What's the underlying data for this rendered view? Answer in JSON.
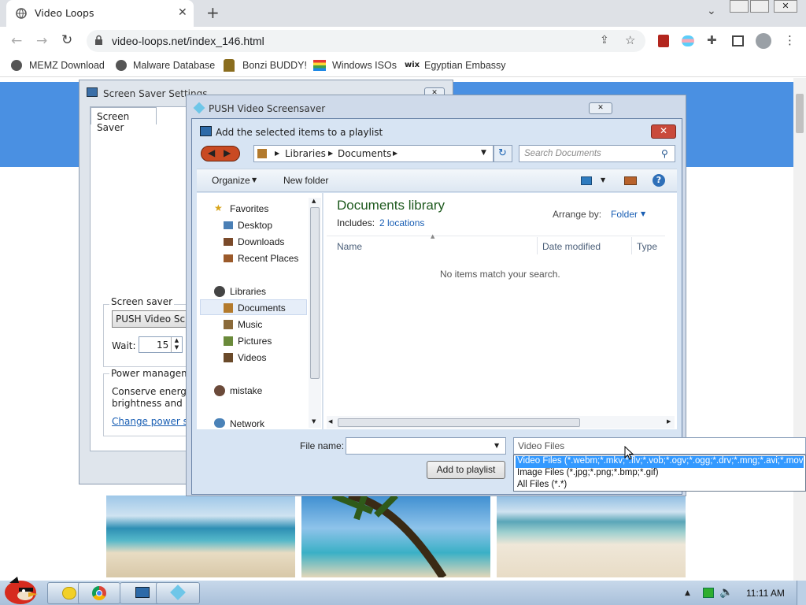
{
  "browser": {
    "tab_title": "Video Loops",
    "url": "video-loops.net/index_146.html",
    "bookmarks": [
      "MEMZ Download",
      "Malware Database",
      "Bonzi BUDDY!",
      "Windows ISOs",
      "Egyptian Embassy"
    ]
  },
  "screensaver_window": {
    "title": "Screen Saver Settings",
    "tab": "Screen Saver",
    "group_label": "Screen saver",
    "selected": "PUSH Video Scree",
    "wait_label": "Wait:",
    "wait_value": "15",
    "power_label": "Power manageme",
    "power_text1": "Conserve energy o",
    "power_text2": "brightness and oth",
    "power_link": "Change power set"
  },
  "push_window": {
    "title": "PUSH Video Screensaver"
  },
  "dialog": {
    "title": "Add the selected items to a playlist",
    "breadcrumb": [
      "Libraries",
      "Documents"
    ],
    "search_placeholder": "Search Documents",
    "organize": "Organize",
    "new_folder": "New folder",
    "nav": {
      "favorites": "Favorites",
      "fav_items": [
        "Desktop",
        "Downloads",
        "Recent Places"
      ],
      "libraries": "Libraries",
      "lib_items": [
        "Documents",
        "Music",
        "Pictures",
        "Videos"
      ],
      "user": "mistake",
      "network": "Network"
    },
    "library_title": "Documents library",
    "includes_label": "Includes:",
    "includes_link": "2 locations",
    "arrange_label": "Arrange by:",
    "arrange_value": "Folder",
    "columns": [
      "Name",
      "Date modified",
      "Type"
    ],
    "empty_message": "No items match your search.",
    "filename_label": "File name:",
    "filename_value": "",
    "filetype_value": "Video Files",
    "filetype_options": [
      "Video Files (*.webm;*.mkv;*.flv;*.vob;*.ogv;*.ogg;*.drv;*.mng;*.avi;*.mov;*.qt)",
      "Image Files (*.jpg;*.png;*.bmp;*.gif)",
      "All Files (*.*)"
    ],
    "add_button": "Add to playlist"
  },
  "taskbar": {
    "clock": "11:11 AM"
  }
}
